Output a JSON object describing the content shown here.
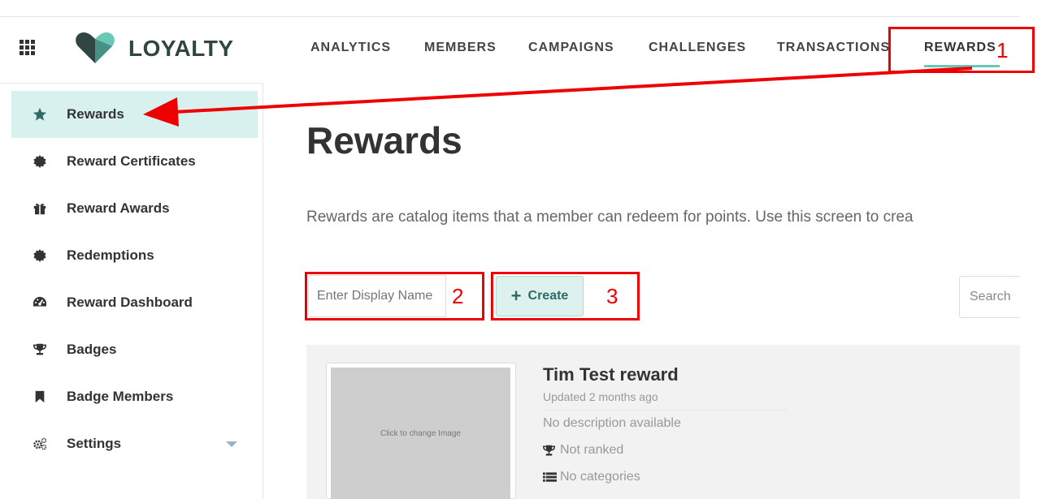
{
  "app": {
    "logo_text": "LOYALTY",
    "accent_color": "#69c7b8",
    "logo_dark": "#2f4643"
  },
  "nav": {
    "items": [
      {
        "label": "ANALYTICS"
      },
      {
        "label": "MEMBERS"
      },
      {
        "label": "CAMPAIGNS"
      },
      {
        "label": "CHALLENGES"
      },
      {
        "label": "TRANSACTIONS"
      },
      {
        "label": "REWARDS",
        "active": true
      }
    ]
  },
  "sidebar": {
    "items": [
      {
        "label": "Rewards",
        "icon": "star-icon",
        "active": true
      },
      {
        "label": "Reward Certificates",
        "icon": "certificate-icon"
      },
      {
        "label": "Reward Awards",
        "icon": "gift-icon"
      },
      {
        "label": "Redemptions",
        "icon": "certificate-icon"
      },
      {
        "label": "Reward Dashboard",
        "icon": "dashboard-icon"
      },
      {
        "label": "Badges",
        "icon": "trophy-icon"
      },
      {
        "label": "Badge Members",
        "icon": "bookmark-icon"
      },
      {
        "label": "Settings",
        "icon": "cogs-icon",
        "expandable": true
      }
    ]
  },
  "main": {
    "title": "Rewards",
    "description": "Rewards are catalog items that a member can redeem for points. Use this screen to crea",
    "display_name_placeholder": "Enter Display Name",
    "create_label": "Create",
    "search_placeholder": "Search"
  },
  "reward_card": {
    "image_text": "Click to change Image",
    "title": "Tim Test reward",
    "updated": "Updated 2 months ago",
    "description": "No description available",
    "rank": "Not ranked",
    "categories": "No categories"
  },
  "annotations": {
    "color": "#e00000",
    "labels": [
      "1",
      "2",
      "3"
    ]
  }
}
